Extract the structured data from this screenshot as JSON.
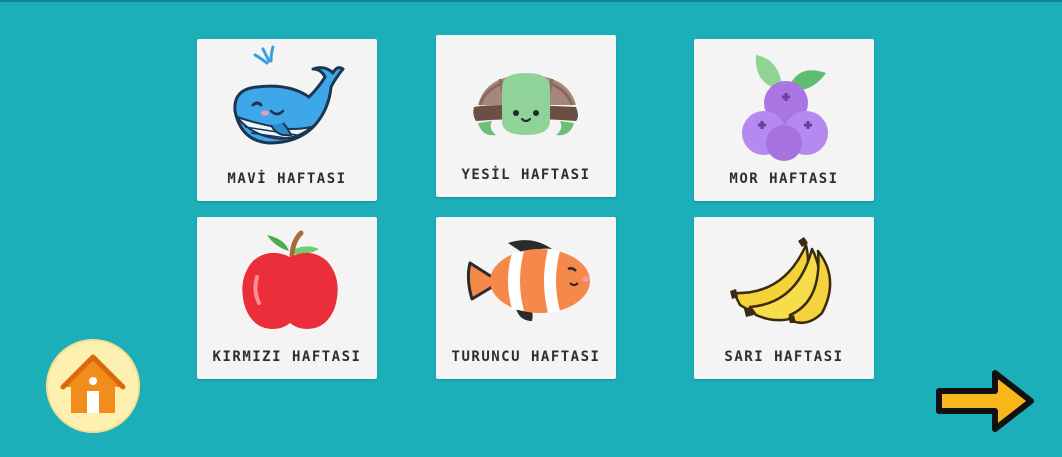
{
  "weeks": [
    {
      "label": "MAVİ HAFTASI",
      "icon": "whale-icon",
      "color": "#3aa6e8"
    },
    {
      "label": "YESİL HAFTASI",
      "icon": "turtle-icon",
      "color": "#8fd39a"
    },
    {
      "label": "MOR HAFTASI",
      "icon": "blueberry-icon",
      "color": "#b58ae8"
    },
    {
      "label": "KIRMIZI HAFTASI",
      "icon": "apple-icon",
      "color": "#e8323c"
    },
    {
      "label": "TURUNCU HAFTASI",
      "icon": "clownfish-icon",
      "color": "#f5884a"
    },
    {
      "label": "SARI HAFTASI",
      "icon": "banana-icon",
      "color": "#f6d23a"
    }
  ],
  "navigation": {
    "home_icon": "home-icon",
    "next_icon": "arrow-right-icon",
    "home_color": "#f28c1c",
    "next_color": "#f7b71a"
  },
  "colors": {
    "background": "#1dafb9",
    "card": "#f4f4f4"
  }
}
